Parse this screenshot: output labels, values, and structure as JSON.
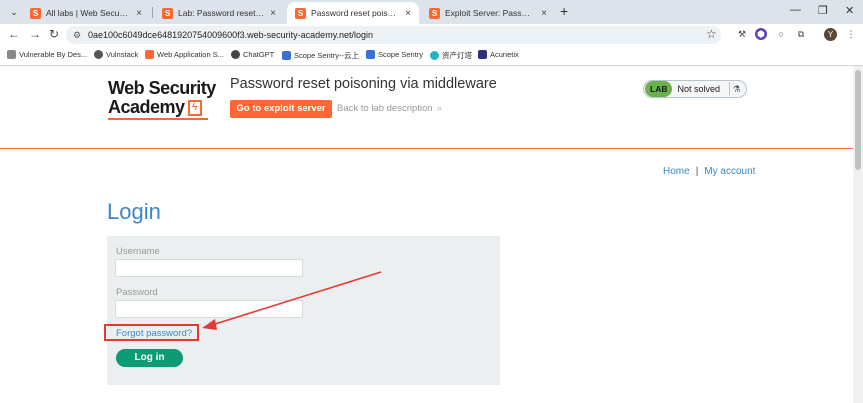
{
  "browser": {
    "tabs": [
      {
        "title": "All labs | Web Security Acade",
        "active": false
      },
      {
        "title": "Lab: Password reset poisonin",
        "active": false
      },
      {
        "title": "Password reset poisoning via",
        "active": true
      },
      {
        "title": "Exploit Server: Password rese",
        "active": false
      }
    ],
    "url": "0ae100c6049dce6481920754009600f3.web-security-academy.net/login",
    "bookmarks": [
      {
        "label": "Vulnerable By Des...",
        "icon": "folder-icon"
      },
      {
        "label": "Vulnstack",
        "icon": "globe-icon"
      },
      {
        "label": "Web Application S...",
        "icon": "portswigger-icon"
      },
      {
        "label": "ChatGPT",
        "icon": "chatgpt-icon"
      },
      {
        "label": "Scope Sentry--云上",
        "icon": "sentry-icon"
      },
      {
        "label": "Scope Sentry",
        "icon": "sentry-icon"
      },
      {
        "label": "资产灯塔",
        "icon": "lighthouse-icon"
      },
      {
        "label": "Acunetix",
        "icon": "acunetix-icon"
      }
    ],
    "avatar_initial": "Y"
  },
  "header": {
    "logo_line1": "Web Security",
    "logo_line2": "Academy",
    "lab_title": "Password reset poisoning via middleware",
    "exploit_button": "Go to exploit server",
    "back_link": "Back to lab description",
    "lab_badge": "LAB",
    "lab_status": "Not solved"
  },
  "nav": {
    "home": "Home",
    "separator": "|",
    "account": "My account"
  },
  "login": {
    "heading": "Login",
    "username_label": "Username",
    "username_value": "",
    "password_label": "Password",
    "password_value": "",
    "forgot_link": "Forgot password?",
    "submit": "Log in"
  },
  "colors": {
    "brand": "#ff6633",
    "link": "#3b88c3",
    "submit": "#0f9a76",
    "annotation": "#e53935"
  }
}
